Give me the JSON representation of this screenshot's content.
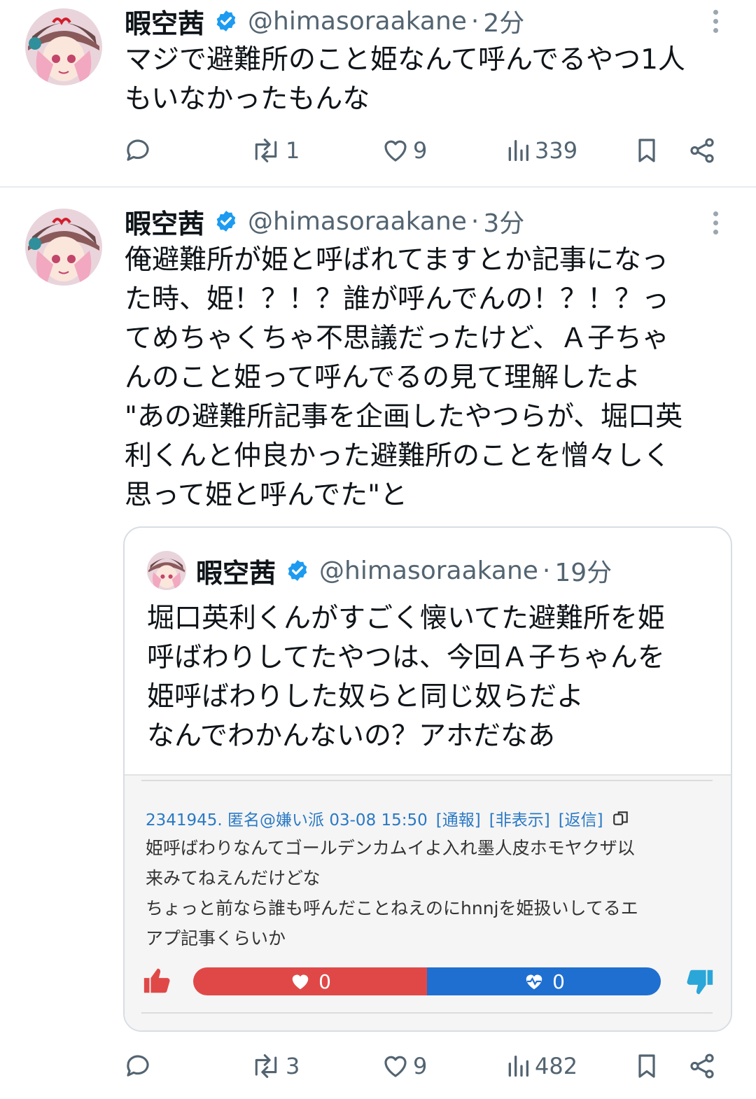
{
  "tweets": [
    {
      "name": "暇空茜",
      "handle": "@himasoraakane",
      "time": "2分",
      "text_lines": [
        "マジで避難所のこと姫なんて呼んでるやつ1人",
        "もいなかったもんな"
      ],
      "stats": {
        "replies": "",
        "reposts": "1",
        "likes": "9",
        "views": "339"
      }
    },
    {
      "name": "暇空茜",
      "handle": "@himasoraakane",
      "time": "3分",
      "text_lines": [
        "俺避難所が姫と呼ばれてますとか記事になっ",
        "た時、姫！？！？誰が呼んでんの！？！？っ",
        "てめちゃくちゃ不思議だったけど、Ａ子ちゃ",
        "んのこと姫って呼んでるの見て理解したよ",
        "\"あの避難所記事を企画したやつらが、堀口英",
        "利くんと仲良かった避難所のことを憎々しく",
        "思って姫と呼んでた\"と"
      ],
      "stats": {
        "replies": "",
        "reposts": "3",
        "likes": "9",
        "views": "482"
      },
      "quote": {
        "name": "暇空茜",
        "handle": "@himasoraakane",
        "time": "19分",
        "text_lines": [
          "堀口英利くんがすごく懐いてた避難所を姫",
          "呼ばわりしてたやつは、今回Ａ子ちゃんを",
          "姫呼ばわりした奴らと同じ奴らだよ",
          "なんでわかんないの？アホだなあ"
        ],
        "media": {
          "meta": "2341945. 匿名@嫌い派 03-08 15:50",
          "links": [
            "[通報]",
            "[非表示]",
            "[返信]"
          ],
          "body_lines": [
            "姫呼ばわりなんてゴールデンカムイよ入れ墨人皮ホモヤクザ以",
            "来みてねえんだけどな",
            "ちょっと前なら誰も呼んだことねえのにhnnjを姫扱いしてるエ",
            "アプ記事くらいか"
          ],
          "votes": {
            "good": "0",
            "bad": "0"
          }
        }
      }
    }
  ],
  "colors": {
    "verified": "#1d9bf0",
    "good_bar": "#e04848",
    "bad_bar": "#1f6fd0"
  }
}
